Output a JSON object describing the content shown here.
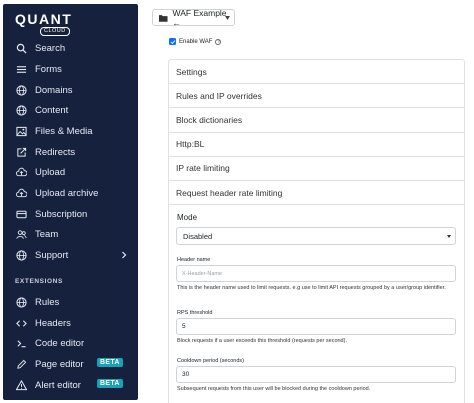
{
  "brand": {
    "name": "QUANT",
    "sub": "CLOUD"
  },
  "sidebar": {
    "items": [
      {
        "label": "Search",
        "icon": "search-icon"
      },
      {
        "label": "Forms",
        "icon": "list-icon"
      },
      {
        "label": "Domains",
        "icon": "globe-icon"
      },
      {
        "label": "Content",
        "icon": "globe-icon"
      },
      {
        "label": "Files & Media",
        "icon": "image-icon"
      },
      {
        "label": "Redirects",
        "icon": "external-link-icon"
      },
      {
        "label": "Upload",
        "icon": "cloud-upload-icon"
      },
      {
        "label": "Upload archive",
        "icon": "cloud-upload-icon"
      },
      {
        "label": "Subscription",
        "icon": "card-icon"
      },
      {
        "label": "Team",
        "icon": "users-icon"
      },
      {
        "label": "Support",
        "icon": "globe-icon"
      }
    ],
    "extensions_label": "EXTENSIONS",
    "extensions": [
      {
        "label": "Rules",
        "icon": "globe-icon"
      },
      {
        "label": "Headers",
        "icon": "code-icon"
      },
      {
        "label": "Code editor",
        "icon": "terminal-icon"
      },
      {
        "label": "Page editor",
        "icon": "edit-icon",
        "badge": "BETA"
      },
      {
        "label": "Alert editor",
        "icon": "alert-icon",
        "badge": "BETA"
      }
    ],
    "bg_color": "#16213e",
    "badge_color": "#17a2b8"
  },
  "project_select": {
    "value": "WAF Example ←"
  },
  "waf": {
    "enable_label": "Enable WAF",
    "sections": [
      "Settings",
      "Rules and IP overrides",
      "Block dictionaries",
      "Http:BL",
      "IP rate limiting",
      "Request header rate limiting"
    ],
    "mode_label": "Mode",
    "mode_value": "Disabled",
    "header_name_label": "Header name",
    "header_name_placeholder": "X-Header-Name",
    "header_name_help": "This is the header name used to limit requests. e.g use to limit API requests grouped by a user/group identifier.",
    "rps_label": "RPS threshold",
    "rps_value": "5",
    "rps_help": "Block requests if a user exceeds this threshold (requests per second).",
    "cooldown_label": "Cooldown period (seconds)",
    "cooldown_value": "30",
    "cooldown_help": "Subsequent requests from this user will be blocked during the cooldown period."
  }
}
